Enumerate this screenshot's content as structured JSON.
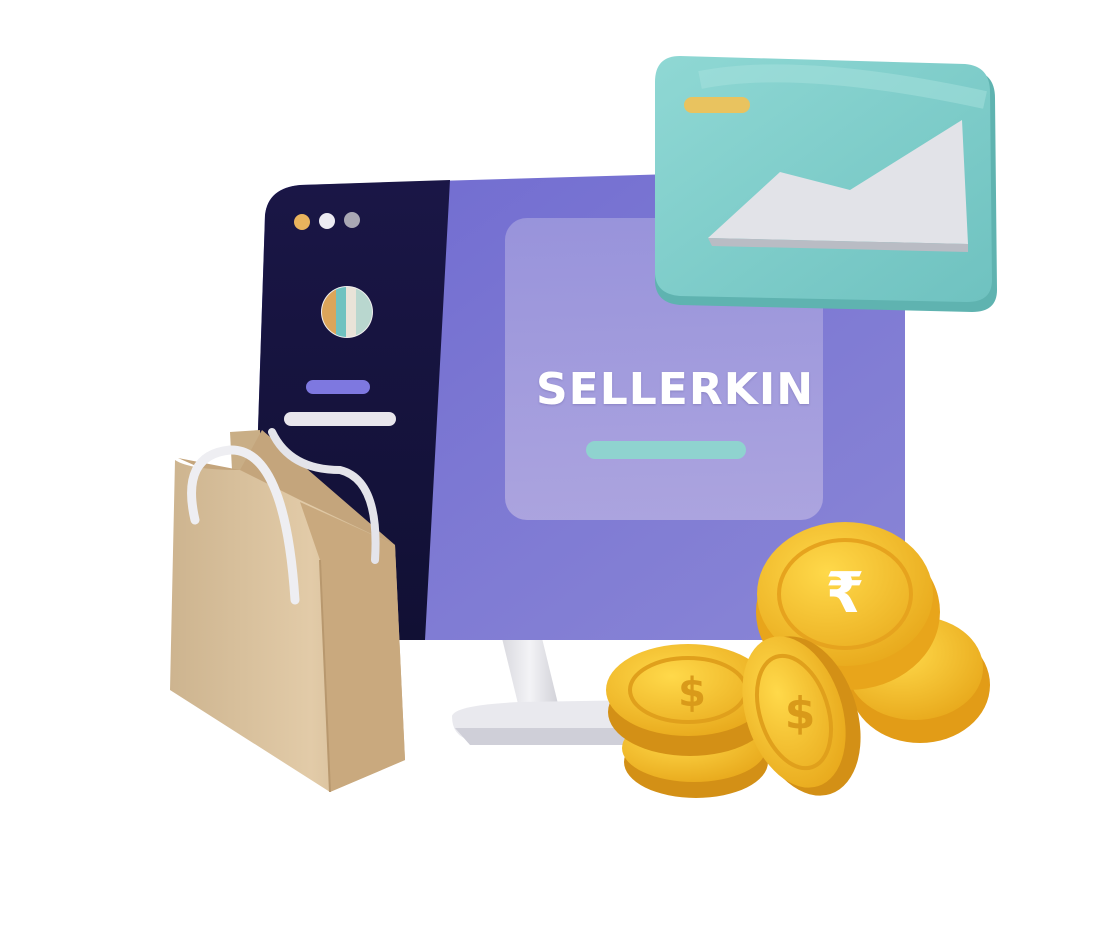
{
  "scene": {
    "brand_name": "SELLERKIN",
    "coin_symbols": [
      "₹",
      "$",
      "$",
      "$"
    ]
  },
  "colors": {
    "monitor_sidebar": "#15123c",
    "monitor_screen": "#7f79d0",
    "center_card": "#a79ed8",
    "chart_card": "#7fd0cc",
    "bag": "#d9c09b",
    "coin": "#f2c12a",
    "stand": "#e4e4e8"
  }
}
